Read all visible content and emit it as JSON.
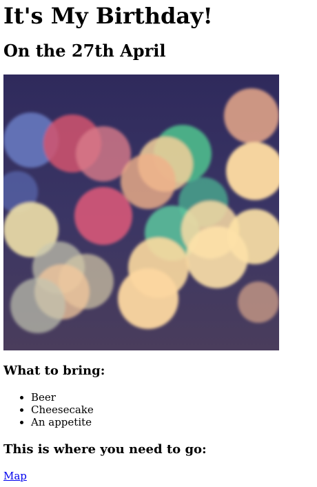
{
  "page": {
    "title": "It's My Birthday!",
    "subtitle": "On the 27th April"
  },
  "image": {
    "alt": "Bokeh lights photo"
  },
  "bring": {
    "heading": "What to bring:",
    "items": [
      "Beer",
      "Cheesecake",
      "An appetite"
    ]
  },
  "directions": {
    "heading": "This is where you need to go:",
    "link_label": "Map"
  },
  "colors": {
    "link": "#0000ee",
    "text": "#000000",
    "photo_background": "#2a2a5a"
  }
}
